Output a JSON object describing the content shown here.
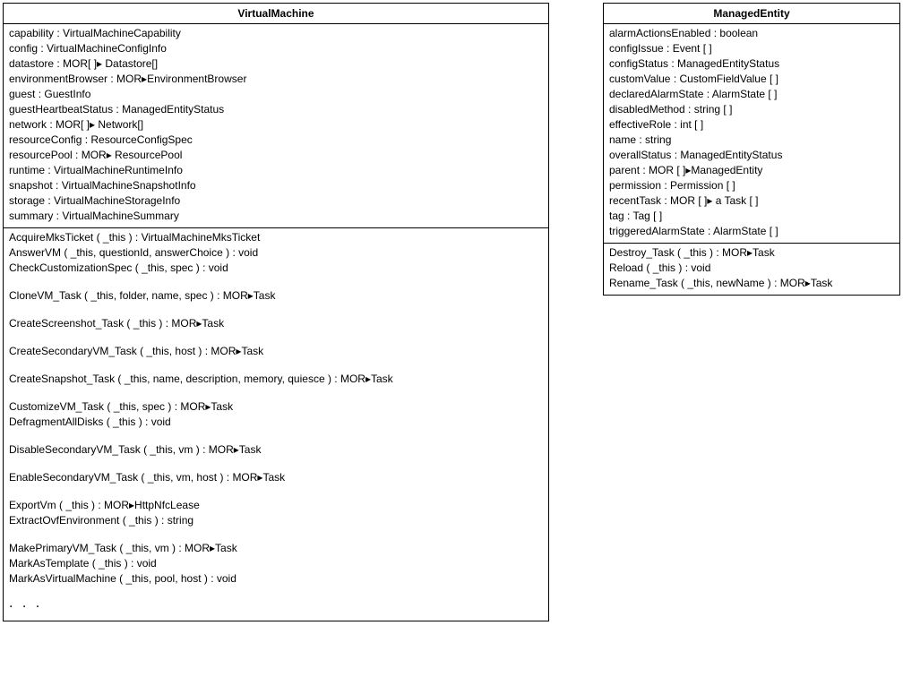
{
  "vm": {
    "title": "VirtualMachine",
    "attributes": [
      "capability : VirtualMachineCapability",
      "config : VirtualMachineConfigInfo",
      "datastore : MOR[ ]▸ Datastore[]",
      "environmentBrowser : MOR▸EnvironmentBrowser",
      "guest : GuestInfo",
      "guestHeartbeatStatus : ManagedEntityStatus",
      "network : MOR[ ]▸ Network[]",
      "resourceConfig : ResourceConfigSpec",
      "resourcePool : MOR▸ ResourcePool",
      "runtime : VirtualMachineRuntimeInfo",
      "snapshot : VirtualMachineSnapshotInfo",
      "storage : VirtualMachineStorageInfo",
      "summary : VirtualMachineSummary"
    ],
    "methods": [
      {
        "text": "AcquireMksTicket ( _this ) : VirtualMachineMksTicket",
        "gap": false
      },
      {
        "text": "AnswerVM ( _this, questionId, answerChoice ) : void",
        "gap": false
      },
      {
        "text": "CheckCustomizationSpec ( _this, spec ) : void",
        "gap": false
      },
      {
        "text": "CloneVM_Task ( _this, folder, name, spec ) : MOR▸Task",
        "gap": true
      },
      {
        "text": "CreateScreenshot_Task ( _this ) : MOR▸Task",
        "gap": true
      },
      {
        "text": "CreateSecondaryVM_Task ( _this, host ) : MOR▸Task",
        "gap": true
      },
      {
        "text": "CreateSnapshot_Task ( _this, name, description, memory, quiesce ) : MOR▸Task",
        "gap": true
      },
      {
        "text": "CustomizeVM_Task ( _this, spec ) : MOR▸Task",
        "gap": true
      },
      {
        "text": "DefragmentAllDisks ( _this ) : void",
        "gap": false
      },
      {
        "text": "DisableSecondaryVM_Task ( _this, vm ) : MOR▸Task",
        "gap": true
      },
      {
        "text": "EnableSecondaryVM_Task ( _this, vm, host ) : MOR▸Task",
        "gap": true
      },
      {
        "text": "ExportVm ( _this ) : MOR▸HttpNfcLease",
        "gap": true
      },
      {
        "text": "ExtractOvfEnvironment ( _this ) : string",
        "gap": false
      },
      {
        "text": "MakePrimaryVM_Task ( _this, vm ) : MOR▸Task",
        "gap": true
      },
      {
        "text": "MarkAsTemplate ( _this ) : void",
        "gap": false
      },
      {
        "text": "MarkAsVirtualMachine ( _this, pool, host ) : void",
        "gap": false
      }
    ],
    "ellipsis": ". . ."
  },
  "me": {
    "title": "ManagedEntity",
    "attributes": [
      "alarmActionsEnabled : boolean",
      "configIssue : Event [ ]",
      "configStatus : ManagedEntityStatus",
      "customValue : CustomFieldValue [ ]",
      "declaredAlarmState : AlarmState [ ]",
      "disabledMethod : string [ ]",
      "effectiveRole : int [ ]",
      "name : string",
      "overallStatus : ManagedEntityStatus",
      "parent : MOR [ ]▸ManagedEntity",
      "permission : Permission [ ]",
      "recentTask : MOR [ ]▸ a Task [ ]",
      "tag : Tag [ ]",
      "triggeredAlarmState : AlarmState [ ]"
    ],
    "methods": [
      {
        "text": "Destroy_Task ( _this ) : MOR▸Task",
        "gap": false
      },
      {
        "text": "Reload ( _this ) : void",
        "gap": false
      },
      {
        "text": "Rename_Task ( _this, newName ) : MOR▸Task",
        "gap": false
      }
    ]
  }
}
